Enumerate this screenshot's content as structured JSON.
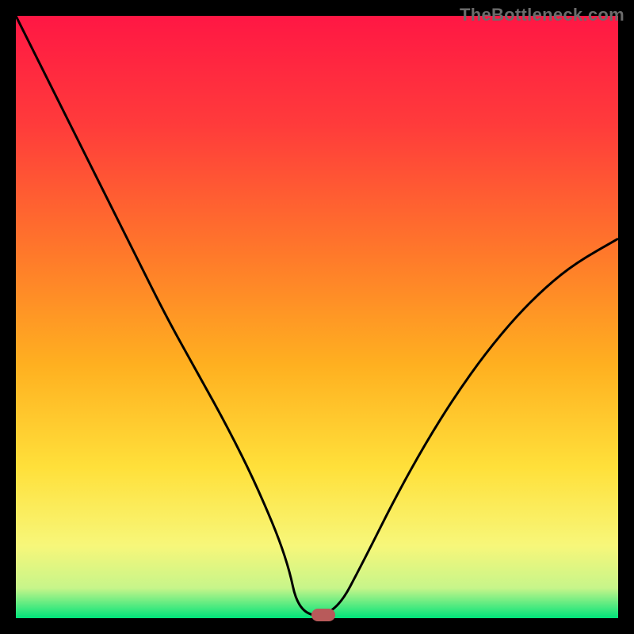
{
  "watermark": "TheBottleneck.com",
  "gradient_stops": [
    {
      "offset": "0%",
      "color": "#ff1744"
    },
    {
      "offset": "18%",
      "color": "#ff3b3b"
    },
    {
      "offset": "40%",
      "color": "#ff7a2a"
    },
    {
      "offset": "58%",
      "color": "#ffb020"
    },
    {
      "offset": "75%",
      "color": "#ffe03a"
    },
    {
      "offset": "88%",
      "color": "#f7f77a"
    },
    {
      "offset": "95%",
      "color": "#c7f58a"
    },
    {
      "offset": "100%",
      "color": "#00e37a"
    }
  ],
  "marker_color": "#b85a5a",
  "chart_data": {
    "type": "line",
    "title": "",
    "xlabel": "",
    "ylabel": "",
    "xlim": [
      0,
      100
    ],
    "ylim": [
      0,
      100
    ],
    "flat_bottom": {
      "x_start": 47,
      "x_end": 53,
      "y": 0.5
    },
    "optimum_marker": {
      "x": 51,
      "y": 0.5
    },
    "series": [
      {
        "name": "bottleneck-curve",
        "x": [
          0,
          5,
          10,
          15,
          20,
          25,
          30,
          35,
          40,
          45,
          47,
          53,
          58,
          63,
          68,
          73,
          78,
          83,
          88,
          93,
          100
        ],
        "values": [
          100,
          90,
          80,
          70,
          60,
          50,
          41,
          32,
          22,
          10,
          0.5,
          0.5,
          10,
          20,
          29,
          37,
          44,
          50,
          55,
          59,
          63
        ]
      }
    ]
  }
}
